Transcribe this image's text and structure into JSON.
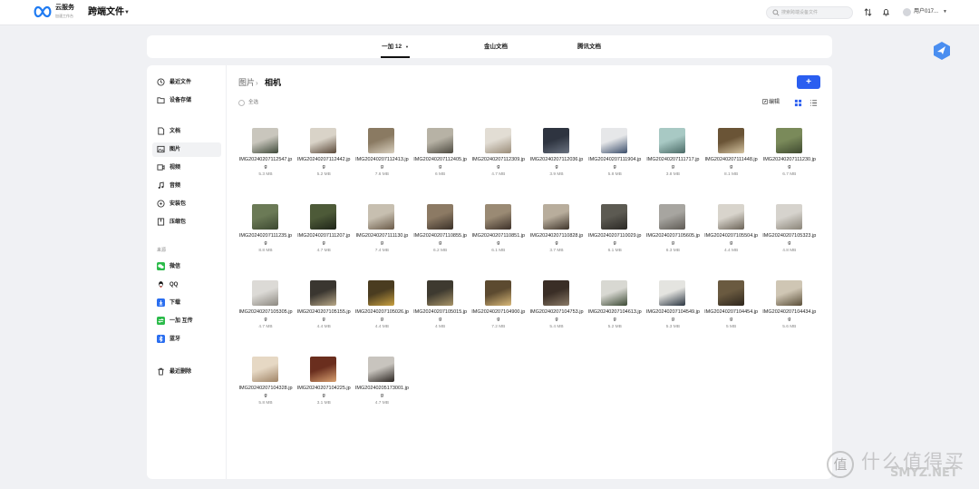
{
  "brand": {
    "name": "云服务",
    "sub": "加速工作台"
  },
  "app_title": "跨端文件",
  "search": {
    "placeholder": "搜索跨端设备文件"
  },
  "user": {
    "name": "用户017..."
  },
  "tabs": [
    {
      "label": "一加 12",
      "active": true
    },
    {
      "label": "金山文档",
      "active": false
    },
    {
      "label": "腾讯文档",
      "active": false
    }
  ],
  "sidebar": {
    "items_top": [
      {
        "label": "最近文件",
        "icon": "clock-icon"
      },
      {
        "label": "设备存储",
        "icon": "folder-icon"
      }
    ],
    "items_types": [
      {
        "label": "文档",
        "icon": "document-icon"
      },
      {
        "label": "图片",
        "icon": "image-icon",
        "active": true
      },
      {
        "label": "视频",
        "icon": "video-icon"
      },
      {
        "label": "音频",
        "icon": "music-icon"
      },
      {
        "label": "安装包",
        "icon": "package-icon"
      },
      {
        "label": "压缩包",
        "icon": "archive-icon"
      }
    ],
    "section_label": "来源",
    "items_sources": [
      {
        "label": "微信",
        "icon": "wechat-icon",
        "color": "#2bbb4a"
      },
      {
        "label": "QQ",
        "icon": "qq-icon",
        "color": "#e63b2e"
      },
      {
        "label": "下载",
        "icon": "download-icon",
        "color": "#2a6ef0"
      },
      {
        "label": "一加 互传",
        "icon": "share-icon",
        "color": "#2bbb4a"
      },
      {
        "label": "蓝牙",
        "icon": "bluetooth-icon",
        "color": "#2a6ef0"
      }
    ],
    "recent_deleted": {
      "label": "最近删除",
      "icon": "trash-icon"
    }
  },
  "breadcrumb": {
    "parent": "图片",
    "current": "相机"
  },
  "toolbar": {
    "select_all": "全选",
    "edit": "编辑",
    "add": "+"
  },
  "files": [
    {
      "name": "IMG20240207112547.jpg",
      "size": "5.3 MB",
      "thumb": [
        "#c9c6bd",
        "#3f4a3a"
      ]
    },
    {
      "name": "IMG20240207112442.jpg",
      "size": "5.2 MB",
      "thumb": [
        "#d9d3c8",
        "#5a4838"
      ]
    },
    {
      "name": "IMG20240207112413.jpg",
      "size": "7.6 MB",
      "thumb": [
        "#8a7a62",
        "#d8cfbe"
      ]
    },
    {
      "name": "IMG20240207112405.jpg",
      "size": "6 MB",
      "thumb": [
        "#b7b2a5",
        "#4d4a40"
      ]
    },
    {
      "name": "IMG20240207112309.jpg",
      "size": "4.7 MB",
      "thumb": [
        "#e2ddd4",
        "#9a8c78"
      ]
    },
    {
      "name": "IMG20240207112036.jpg",
      "size": "3.9 MB",
      "thumb": [
        "#2e3440",
        "#6a7280"
      ]
    },
    {
      "name": "IMG20240207111904.jpg",
      "size": "5.8 MB",
      "thumb": [
        "#e6e7e9",
        "#3a4d6a"
      ]
    },
    {
      "name": "IMG20240207111717.jpg",
      "size": "3.8 MB",
      "thumb": [
        "#a8c9c4",
        "#4a6a66"
      ]
    },
    {
      "name": "IMG20240207111448.jpg",
      "size": "8.1 MB",
      "thumb": [
        "#6a5436",
        "#d4c3a0"
      ]
    },
    {
      "name": "IMG20240207111230.jpg",
      "size": "6.7 MB",
      "thumb": [
        "#7a8a5a",
        "#3f4a30"
      ]
    },
    {
      "name": "IMG20240207111235.jpg",
      "size": "8.8 MB",
      "thumb": [
        "#6b7a56",
        "#3c4830"
      ]
    },
    {
      "name": "IMG20240207111207.jpg",
      "size": "4.7 MB",
      "thumb": [
        "#4d5a38",
        "#1e2418"
      ]
    },
    {
      "name": "IMG20240207111130.jpg",
      "size": "7.4 MB",
      "thumb": [
        "#c7bfb0",
        "#6a5a48"
      ]
    },
    {
      "name": "IMG20240207110855.jpg",
      "size": "6.2 MB",
      "thumb": [
        "#8c7a64",
        "#3a3028"
      ]
    },
    {
      "name": "IMG20240207110851.jpg",
      "size": "6.1 MB",
      "thumb": [
        "#9a8a74",
        "#3c3028"
      ]
    },
    {
      "name": "IMG20240207110828.jpg",
      "size": "3.7 MB",
      "thumb": [
        "#b8ad9c",
        "#3e342a"
      ]
    },
    {
      "name": "IMG20240207110029.jpg",
      "size": "6.1 MB",
      "thumb": [
        "#5c5a52",
        "#2a2824"
      ]
    },
    {
      "name": "IMG20240207105605.jpg",
      "size": "6.3 MB",
      "thumb": [
        "#a7a5a0",
        "#5e5a54"
      ]
    },
    {
      "name": "IMG20240207105504.jpg",
      "size": "4.4 MB",
      "thumb": [
        "#d8d4cc",
        "#6a6256"
      ]
    },
    {
      "name": "IMG20240207105323.jpg",
      "size": "4.8 MB",
      "thumb": [
        "#d6d3cd",
        "#8a8478"
      ]
    },
    {
      "name": "IMG20240207105305.jpg",
      "size": "4.7 MB",
      "thumb": [
        "#dcdad6",
        "#8c8880"
      ]
    },
    {
      "name": "IMG20240207105155.jpg",
      "size": "4.4 MB",
      "thumb": [
        "#3a3630",
        "#b8a888"
      ]
    },
    {
      "name": "IMG20240207105026.jpg",
      "size": "4.4 MB",
      "thumb": [
        "#4a3c20",
        "#c8a040"
      ]
    },
    {
      "name": "IMG20240207105015.jpg",
      "size": "4 MB",
      "thumb": [
        "#3e3a30",
        "#a89468"
      ]
    },
    {
      "name": "IMG20240207104900.jpg",
      "size": "7.2 MB",
      "thumb": [
        "#5c4a30",
        "#d8b878"
      ]
    },
    {
      "name": "IMG20240207104753.jpg",
      "size": "5.4 MB",
      "thumb": [
        "#3a2e26",
        "#8a7a66"
      ]
    },
    {
      "name": "IMG20240207104613.jpg",
      "size": "5.2 MB",
      "thumb": [
        "#d8d8d2",
        "#3c4a34"
      ]
    },
    {
      "name": "IMG20240207104549.jpg",
      "size": "5.3 MB",
      "thumb": [
        "#e4e4e0",
        "#2a3440"
      ]
    },
    {
      "name": "IMG20240207104454.jpg",
      "size": "5 MB",
      "thumb": [
        "#6a5a40",
        "#2e261c"
      ]
    },
    {
      "name": "IMG20240207104434.jpg",
      "size": "5.6 MB",
      "thumb": [
        "#cfc6b4",
        "#5a4e38"
      ]
    },
    {
      "name": "IMG20240207104328.jpg",
      "size": "5.8 MB",
      "thumb": [
        "#e6d8c4",
        "#a08466"
      ]
    },
    {
      "name": "IMG20240207104225.jpg",
      "size": "3.1 MB",
      "thumb": [
        "#6a2e1e",
        "#d8a070"
      ]
    },
    {
      "name": "IMG20240205173001.jpg",
      "size": "4.7 MB",
      "thumb": [
        "#c8c4be",
        "#2a2420"
      ]
    }
  ],
  "watermark": {
    "circle": "值",
    "text": "什么值得买",
    "sub": "SMYZ.NET"
  },
  "colors": {
    "accent": "#2a5ef0",
    "badge": "#4a8ef0"
  }
}
